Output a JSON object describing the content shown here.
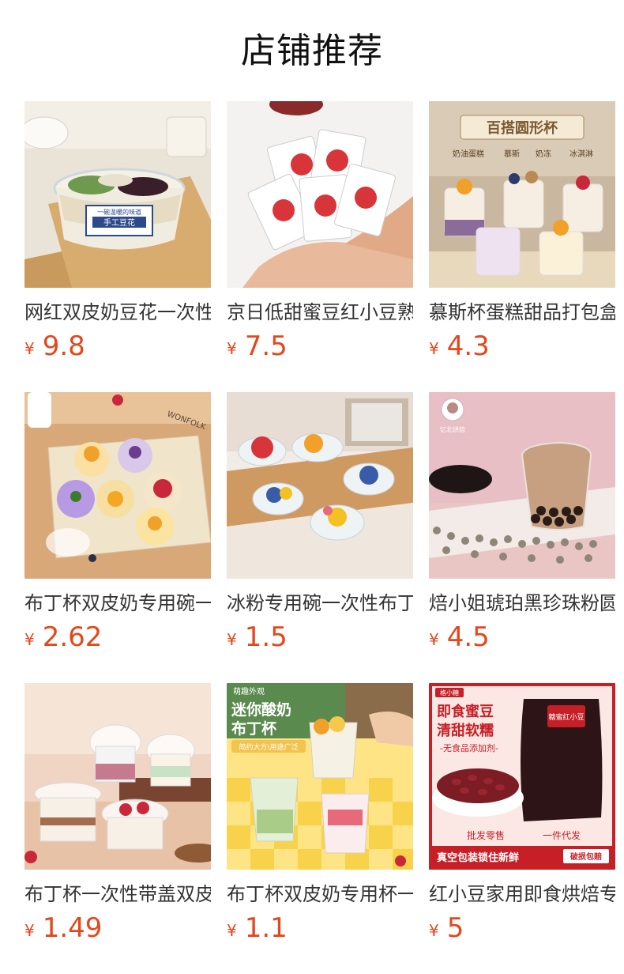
{
  "page": {
    "title": "店铺推荐"
  },
  "currency_symbol": "¥",
  "products": [
    {
      "name": "网红双皮奶豆花一次性",
      "price": "9.8",
      "image_text": [
        "手工豆花",
        "一碗温暖的味道"
      ],
      "image_icon": "pudding-bowl-image"
    },
    {
      "name": "京日低甜蜜豆红小豆熟",
      "price": "7.5",
      "image_text": [],
      "image_icon": "bean-packets-image"
    },
    {
      "name": "慕斯杯蛋糕甜品打包盒",
      "price": "4.3",
      "image_text": [
        "百搭圆形杯",
        "奶油蛋糕",
        "慕斯",
        "奶冻",
        "冰淇淋"
      ],
      "image_icon": "mousse-cups-image"
    },
    {
      "name": "布丁杯双皮奶专用碗一",
      "price": "2.62",
      "image_text": [
        "WONFOLK"
      ],
      "image_icon": "pudding-tray-image"
    },
    {
      "name": "冰粉专用碗一次性布丁",
      "price": "1.5",
      "image_text": [],
      "image_icon": "fruit-cups-image"
    },
    {
      "name": "焙小姐琥珀黑珍珠粉圆",
      "price": "4.5",
      "image_text": [
        "忆北烘焙"
      ],
      "image_icon": "tapioca-pearls-image"
    },
    {
      "name": "布丁杯一次性带盖双皮",
      "price": "1.49",
      "image_text": [],
      "image_icon": "lidded-cups-image"
    },
    {
      "name": "布丁杯双皮奶专用杯一",
      "price": "1.1",
      "image_text": [
        "萌趣外观",
        "迷你酸奶",
        "布丁杯",
        "简约大方\\用途广泛"
      ],
      "image_icon": "yogurt-cups-image"
    },
    {
      "name": "红小豆家用即食烘焙专",
      "price": "5",
      "image_text": [
        "格小糖",
        "即食蜜豆",
        "清甜软糯",
        "-无食品添加剂-",
        "批发零售",
        "一件代发",
        "真空包装锁住新鲜",
        "破损包赔",
        "糖蜜红小豆"
      ],
      "image_icon": "red-bean-pack-image"
    }
  ]
}
